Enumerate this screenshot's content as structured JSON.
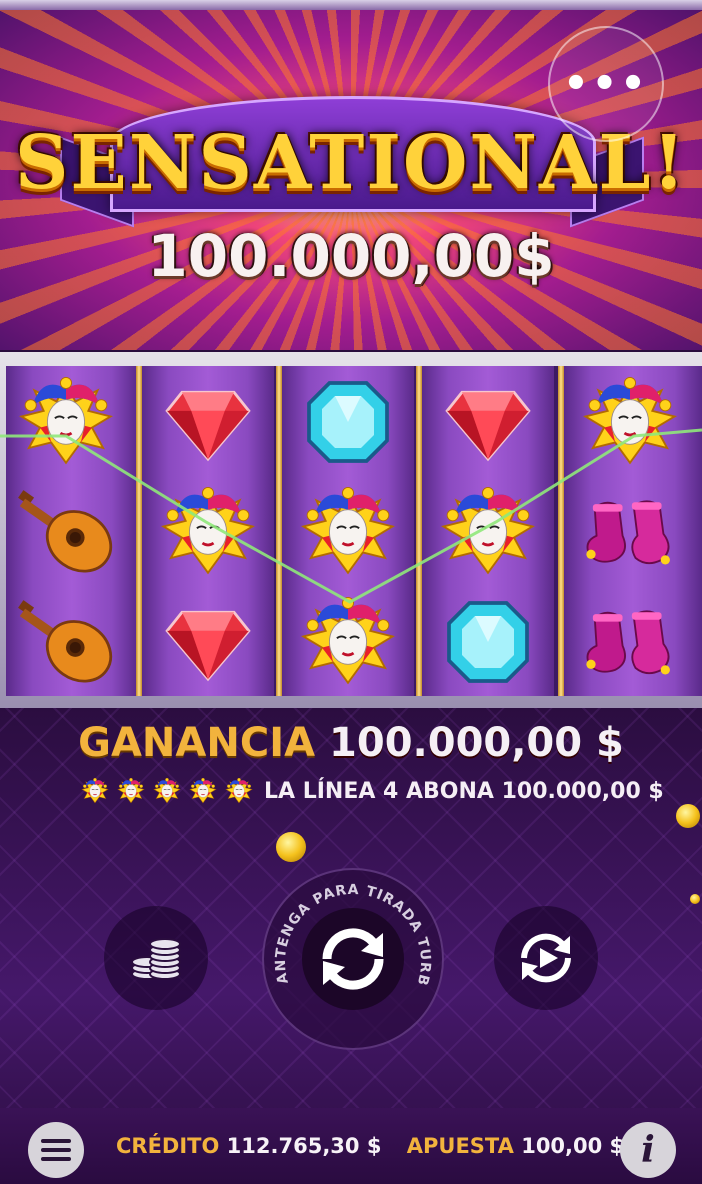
{
  "banner": {
    "title": "SENSATIONAL!",
    "win_amount": "100.000,00$",
    "menu_label": "•••"
  },
  "reels": {
    "columns": [
      [
        "jester",
        "lute",
        "lute"
      ],
      [
        "red-gem",
        "jester",
        "red-gem"
      ],
      [
        "blue-gem",
        "jester",
        "jester"
      ],
      [
        "red-gem",
        "jester",
        "blue-gem"
      ],
      [
        "jester",
        "jester-boots",
        "jester-boots"
      ]
    ]
  },
  "win": {
    "label": "GANANCIA",
    "value": "100.000,00 $",
    "line_text": "LA LÍNEA 4 ABONA 100.000,00 $",
    "line_symbol_count": 5
  },
  "controls": {
    "spin_hint": "MANTENGA PARA TIRADA TURBO",
    "coins_icon": "coin-stack-icon",
    "spin_icon": "spin-arrows-icon",
    "autoplay_icon": "autoplay-icon"
  },
  "footer": {
    "credit_label": "CRÉDITO",
    "credit_value": "112.765,30 $",
    "bet_label": "APUESTA",
    "bet_value": "100,00 $",
    "info_label": "i"
  },
  "colors": {
    "gold": "#f2b33d",
    "purple_bg": "#2a0d3e",
    "reel_purple": "#8a4ac0"
  }
}
